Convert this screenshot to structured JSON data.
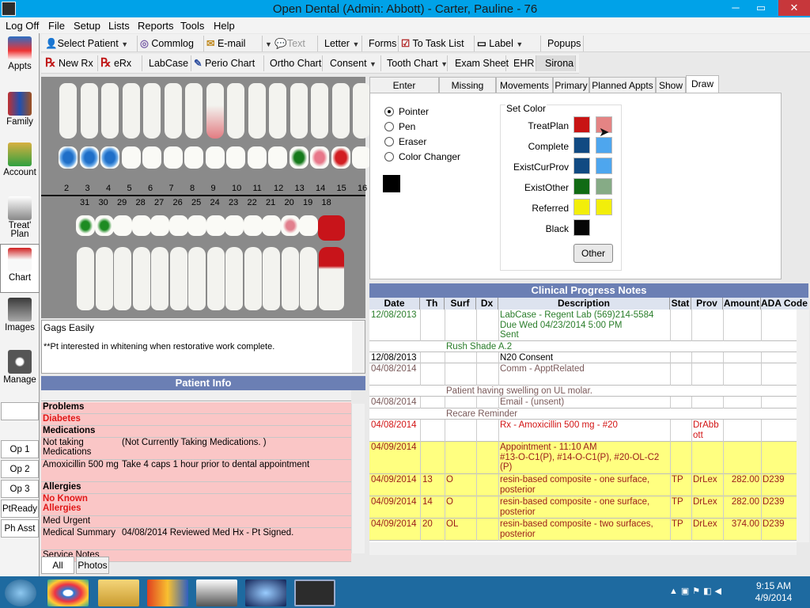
{
  "window": {
    "title": "Open Dental (Admin: Abbott) - Carter, Pauline - 76",
    "min": "─",
    "max": "▭",
    "close": "✕"
  },
  "menu": [
    "Log Off",
    "File",
    "Setup",
    "Lists",
    "Reports",
    "Tools",
    "Help"
  ],
  "toolbar1": {
    "select_patient": "Select Patient",
    "commlog": "Commlog",
    "email": "E-mail",
    "text": "Text",
    "letter": "Letter",
    "forms": "Forms",
    "task_list": "To Task List",
    "label": "Label",
    "popups": "Popups"
  },
  "toolbar2": {
    "new_rx": "New Rx",
    "erx": "eRx",
    "labcase": "LabCase",
    "perio": "Perio Chart",
    "ortho": "Ortho Chart",
    "consent": "Consent",
    "tooth_chart": "Tooth Chart",
    "exam_sheet": "Exam Sheet",
    "ehr": "EHR",
    "sirona": "Sirona"
  },
  "modules": [
    "Appts",
    "Family",
    "Account",
    "Treat' Plan",
    "Chart",
    "Images",
    "Manage"
  ],
  "ops": [
    "Op 1",
    "Op 2",
    "Op 3",
    "PtReady",
    "Ph Asst"
  ],
  "teeth_upper": [
    "2",
    "3",
    "4",
    "5",
    "6",
    "7",
    "8",
    "9",
    "10",
    "11",
    "12",
    "13",
    "14",
    "15",
    "16"
  ],
  "teeth_lower": [
    "31",
    "30",
    "29",
    "28",
    "27",
    "26",
    "25",
    "24",
    "23",
    "22",
    "21",
    "20",
    "19",
    "18"
  ],
  "notes": {
    "line1": "Gags Easily",
    "line2": "**Pt interested in whitening when restorative work complete."
  },
  "patient_info": {
    "title": "Patient Info",
    "rows": [
      {
        "a": "Problems",
        "b": "",
        "style": "head"
      },
      {
        "a": "Diabetes",
        "b": "",
        "style": "red"
      },
      {
        "a": "Medications",
        "b": "",
        "style": "head"
      },
      {
        "a": "Not taking Medications",
        "b": "(Not Currently Taking Medications. )",
        "style": "pink"
      },
      {
        "a": "Amoxicillin 500 mg",
        "b": "Take 4 caps 1 hour prior to dental appointment",
        "style": "pink"
      },
      {
        "a": "Allergies",
        "b": "",
        "style": "head"
      },
      {
        "a": "No Known Allergies",
        "b": "",
        "style": "red"
      },
      {
        "a": "Med Urgent",
        "b": "",
        "style": "pink"
      },
      {
        "a": "Medical Summary",
        "b": "04/08/2014  Reviewed Med Hx - Pt Signed.",
        "style": "pink"
      },
      {
        "a": "Service Notes",
        "b": "",
        "style": "pink"
      }
    ]
  },
  "bottom_tabs": [
    "All",
    "Photos"
  ],
  "chart_tabs": [
    "Enter Treatment",
    "Missing Teeth",
    "Movements",
    "Primary",
    "Planned Appts",
    "Show",
    "Draw"
  ],
  "draw": {
    "tools": [
      "Pointer",
      "Pen",
      "Eraser",
      "Color Changer"
    ],
    "set_color": "Set Color",
    "colors": [
      {
        "label": "TreatPlan",
        "c1": "#c81414",
        "c2": "#e48484"
      },
      {
        "label": "Complete",
        "c1": "#114a82",
        "c2": "#4ea6ee"
      },
      {
        "label": "ExistCurProv",
        "c1": "#114a82",
        "c2": "#4ea6ee"
      },
      {
        "label": "ExistOther",
        "c1": "#116b14",
        "c2": "#86ab86"
      },
      {
        "label": "Referred",
        "c1": "#f2ee0a",
        "c2": "#f2ee0a"
      },
      {
        "label": "Black",
        "c1": "#060606",
        "c2": ""
      }
    ],
    "other": "Other"
  },
  "progress_notes": {
    "title": "Clinical Progress Notes",
    "columns": [
      "Date",
      "Th",
      "Surf",
      "Dx",
      "Description",
      "Stat",
      "Prov",
      "Amount",
      "ADA Code"
    ],
    "rows": [
      {
        "date": "12/08/2013",
        "th": "",
        "surf": "",
        "dx": "",
        "desc": "LabCase - Regent Lab (569)214-5584\nDue Wed 04/23/2014 5:00 PM\nSent",
        "stat": "",
        "prov": "",
        "amt": "",
        "ada": "",
        "color": "#2a7d2a",
        "bg": "#ffffff",
        "h": 40
      },
      {
        "date": "",
        "th": "",
        "surf": "",
        "dx": "",
        "desc": "Rush Shade A.2",
        "note": true,
        "stat": "",
        "prov": "",
        "amt": "",
        "ada": "",
        "color": "#2a7d2a",
        "bg": "#ffffff",
        "h": 14
      },
      {
        "date": "12/08/2013",
        "th": "",
        "surf": "",
        "dx": "",
        "desc": "N20 Consent",
        "stat": "",
        "prov": "",
        "amt": "",
        "ada": "",
        "color": "#000000",
        "bg": "#ffffff",
        "h": 14
      },
      {
        "date": "04/08/2014",
        "th": "",
        "surf": "",
        "dx": "",
        "desc": "Comm - ApptRelated",
        "stat": "",
        "prov": "",
        "amt": "",
        "ada": "",
        "color": "#7a5a5a",
        "bg": "#ffffff",
        "h": 28
      },
      {
        "date": "",
        "th": "",
        "surf": "",
        "dx": "",
        "desc": "Patient having swelling on UL molar.",
        "note": true,
        "stat": "",
        "prov": "",
        "amt": "",
        "ada": "",
        "color": "#7a5a5a",
        "bg": "#ffffff",
        "h": 14
      },
      {
        "date": "04/08/2014",
        "th": "",
        "surf": "",
        "dx": "",
        "desc": "Email - (unsent)",
        "stat": "",
        "prov": "",
        "amt": "",
        "ada": "",
        "color": "#7a5a5a",
        "bg": "#ffffff",
        "h": 15
      },
      {
        "date": "",
        "th": "",
        "surf": "",
        "dx": "",
        "desc": "Recare Reminder",
        "note": true,
        "stat": "",
        "prov": "",
        "amt": "",
        "ada": "",
        "color": "#7a5a5a",
        "bg": "#ffffff",
        "h": 14
      },
      {
        "date": "04/08/2014",
        "th": "",
        "surf": "",
        "dx": "",
        "desc": "Rx - Amoxicillin 500 mg - #20",
        "stat": "",
        "prov": "DrAbb\nott",
        "amt": "",
        "ada": "",
        "color": "#d21414",
        "bg": "#ffffff",
        "h": 28
      },
      {
        "date": "04/09/2014",
        "th": "",
        "surf": "",
        "dx": "",
        "desc": "Appointment - 11:10 AM\n#13-O-C1(P), #14-O-C1(P), #20-OL-C2\n(P)",
        "stat": "",
        "prov": "",
        "amt": "",
        "ada": "",
        "color": "#9a1a1a",
        "bg": "#ffff80",
        "h": 41
      },
      {
        "date": "04/09/2014",
        "th": "13",
        "surf": "O",
        "dx": "",
        "desc": "resin-based composite - one surface,\nposterior",
        "stat": "TP",
        "prov": "DrLex",
        "amt": "282.00",
        "ada": "D239",
        "color": "#9a1a1a",
        "bg": "#ffff80",
        "h": 28
      },
      {
        "date": "04/09/2014",
        "th": "14",
        "surf": "O",
        "dx": "",
        "desc": "resin-based composite - one surface,\nposterior",
        "stat": "TP",
        "prov": "DrLex",
        "amt": "282.00",
        "ada": "D239",
        "color": "#9a1a1a",
        "bg": "#ffff80",
        "h": 28
      },
      {
        "date": "04/09/2014",
        "th": "20",
        "surf": "OL",
        "dx": "",
        "desc": "resin-based composite - two surfaces,\nposterior",
        "stat": "TP",
        "prov": "DrLex",
        "amt": "374.00",
        "ada": "D239",
        "color": "#9a1a1a",
        "bg": "#ffff80",
        "h": 28
      }
    ]
  },
  "taskbar": {
    "time": "9:15 AM",
    "date": "4/9/2014"
  }
}
